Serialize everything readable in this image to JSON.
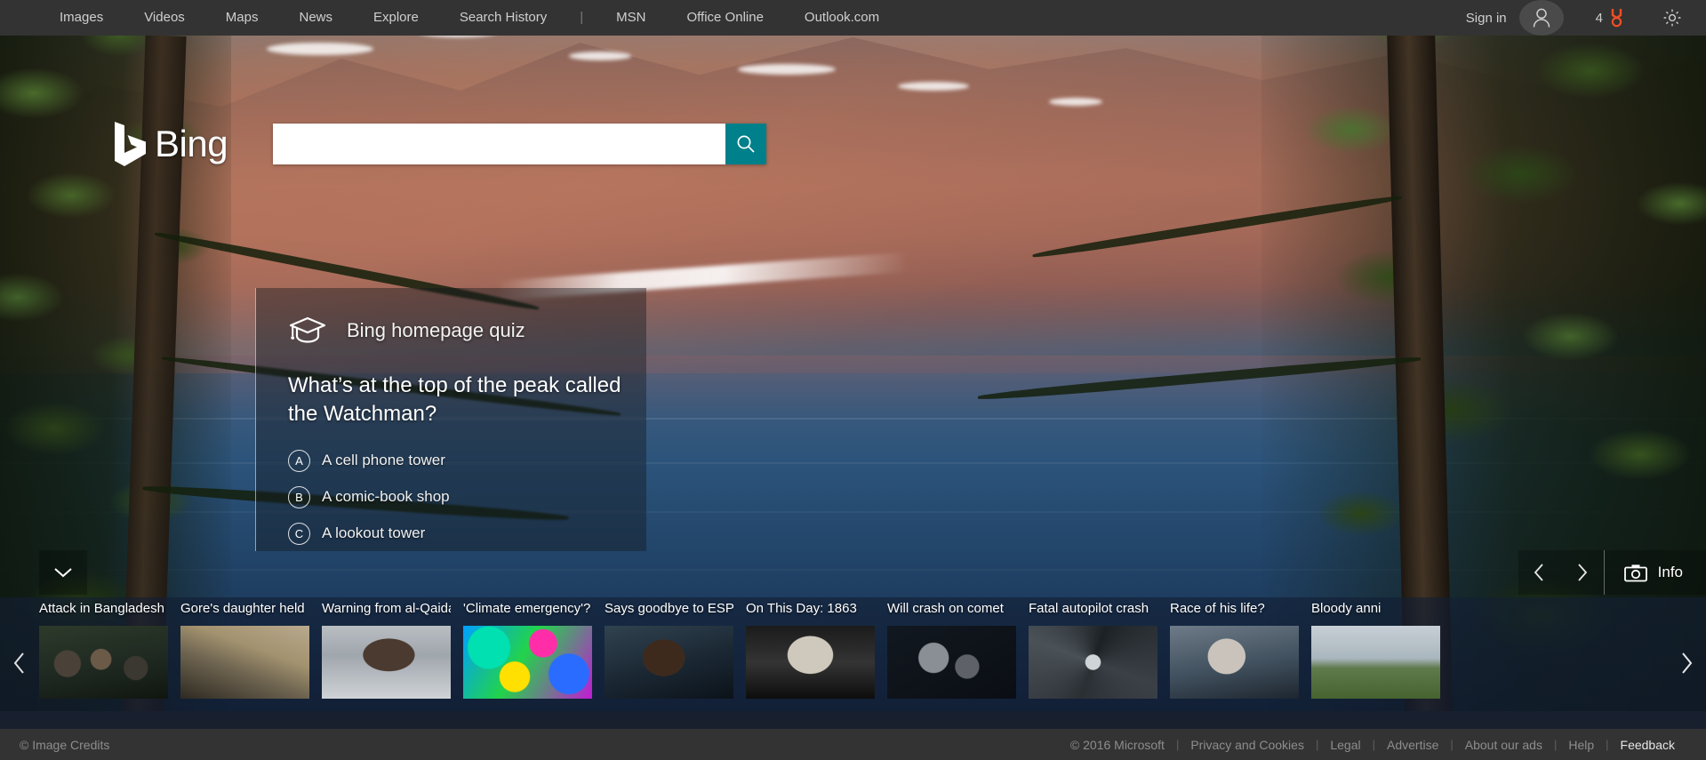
{
  "topnav": {
    "links": [
      {
        "label": "Images",
        "name": "nav-images"
      },
      {
        "label": "Videos",
        "name": "nav-videos"
      },
      {
        "label": "Maps",
        "name": "nav-maps"
      },
      {
        "label": "News",
        "name": "nav-news"
      },
      {
        "label": "Explore",
        "name": "nav-explore"
      },
      {
        "label": "Search History",
        "name": "nav-search-history"
      }
    ],
    "separator": "|",
    "links2": [
      {
        "label": "MSN",
        "name": "nav-msn"
      },
      {
        "label": "Office Online",
        "name": "nav-office-online"
      },
      {
        "label": "Outlook.com",
        "name": "nav-outlook"
      }
    ],
    "sign_in": "Sign in",
    "avatar_icon": "user-avatar-icon",
    "rewards_count": "4",
    "rewards_icon": "rewards-medal-icon",
    "rewards_color": "#f04e23",
    "settings_icon": "gear-icon"
  },
  "search": {
    "logo_text": "Bing",
    "logo_icon": "bing-b-logo-icon",
    "value": "",
    "placeholder": "",
    "button_icon": "search-magnifier-icon",
    "button_color": "#00808a"
  },
  "quiz": {
    "icon": "graduation-cap-icon",
    "title": "Bing homepage quiz",
    "question": "What’s at the top of the peak called the Watchman?",
    "options": [
      {
        "letter": "A",
        "text": "A cell phone tower"
      },
      {
        "letter": "B",
        "text": "A comic-book shop"
      },
      {
        "letter": "C",
        "text": "A lookout tower"
      }
    ]
  },
  "hero_controls": {
    "scroll_down_icon": "chevron-down-icon",
    "prev_icon": "chevron-left-icon",
    "next_icon": "chevron-right-icon",
    "info_icon": "camera-icon",
    "info_label": "Info"
  },
  "news": {
    "scroll_left_icon": "chevron-left-icon",
    "scroll_right_icon": "chevron-right-icon",
    "items": [
      {
        "headline": "Attack in Bangladesh",
        "thumb_class": "t0"
      },
      {
        "headline": "Gore's daughter held",
        "thumb_class": "t1"
      },
      {
        "headline": "Warning from al-Qaida",
        "thumb_class": "t2"
      },
      {
        "headline": "'Climate emergency'?",
        "thumb_class": "t3"
      },
      {
        "headline": "Says goodbye to ESPN",
        "thumb_class": "t4"
      },
      {
        "headline": "On This Day: 1863",
        "thumb_class": "t5"
      },
      {
        "headline": "Will crash on comet",
        "thumb_class": "t6"
      },
      {
        "headline": "Fatal autopilot crash",
        "thumb_class": "t7"
      },
      {
        "headline": "Race of his life?",
        "thumb_class": "t8"
      },
      {
        "headline": "Bloody anni",
        "thumb_class": "t9"
      }
    ]
  },
  "footer": {
    "image_credits": "© Image Credits",
    "copyright": "© 2016 Microsoft",
    "links": [
      {
        "label": "Privacy and Cookies",
        "name": "footer-privacy",
        "strong": false
      },
      {
        "label": "Legal",
        "name": "footer-legal",
        "strong": false
      },
      {
        "label": "Advertise",
        "name": "footer-advertise",
        "strong": false
      },
      {
        "label": "About our ads",
        "name": "footer-about-our-ads",
        "strong": false
      },
      {
        "label": "Help",
        "name": "footer-help",
        "strong": false
      },
      {
        "label": "Feedback",
        "name": "footer-feedback",
        "strong": true
      }
    ],
    "separator": "|"
  }
}
